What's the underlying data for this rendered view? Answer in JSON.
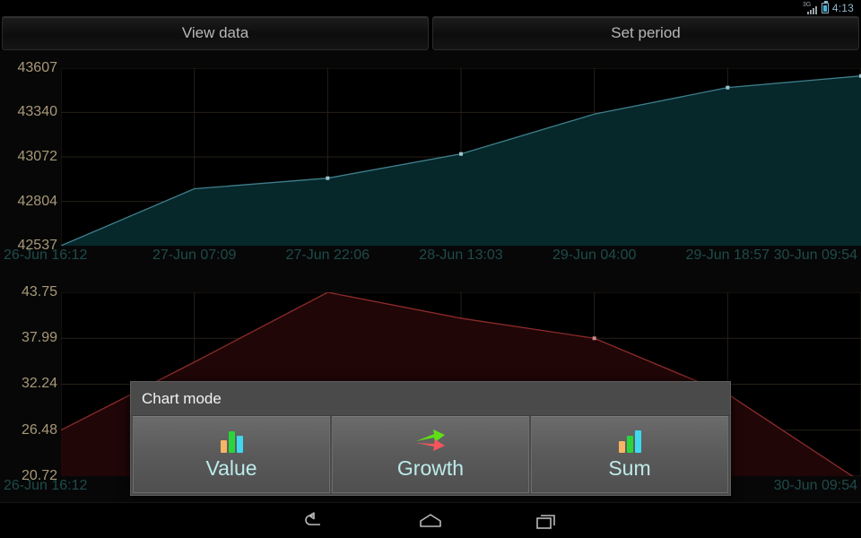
{
  "statusbar": {
    "network_label": "3G",
    "time": "4:13",
    "icons": [
      "signal-icon",
      "battery-icon"
    ]
  },
  "toolbar": {
    "view_data_label": "View data",
    "set_period_label": "Set period"
  },
  "dialog": {
    "title": "Chart mode",
    "options": [
      {
        "label": "Value",
        "icon": "bar-chart-icon"
      },
      {
        "label": "Growth",
        "icon": "growth-arrows-icon"
      },
      {
        "label": "Sum",
        "icon": "ascending-bar-chart-icon"
      }
    ]
  },
  "navbar": {
    "back_label": "Back",
    "home_label": "Home",
    "recents_label": "Recent apps"
  },
  "colors": {
    "top_line": "#3f7f8c",
    "top_fill": "#06282b",
    "bottom_line": "#8c2b2b",
    "bottom_fill": "#200607",
    "y_label": "#a79878",
    "x_label": "#1f4b4b",
    "accent_text": "#bdeaea",
    "icon_orange": "#f6b565",
    "icon_green": "#29d53a",
    "icon_cyan": "#3fd8ee",
    "icon_red": "#f2565a"
  },
  "chart_data": [
    {
      "type": "area",
      "name": "top-chart-value",
      "title": "",
      "xlabel": "",
      "ylabel": "",
      "x": [
        "26-Jun 16:12",
        "27-Jun 07:09",
        "27-Jun 22:06",
        "28-Jun 13:03",
        "29-Jun 04:00",
        "29-Jun 18:57",
        "30-Jun 09:54"
      ],
      "xtick_labels": [
        "26-Jun 16:12",
        "27-Jun 07:09",
        "27-Jun 22:06",
        "28-Jun 13:03",
        "29-Jun 04:00",
        "29-Jun 18:57",
        "30-Jun 09:54"
      ],
      "ytick_labels": [
        "43607",
        "43340",
        "43072",
        "42804",
        "42537"
      ],
      "yticks": [
        43607,
        43340,
        43072,
        42804,
        42537
      ],
      "ylim": [
        42537,
        43607
      ],
      "values": [
        42537,
        42880,
        42944,
        43090,
        43330,
        43490,
        43560
      ],
      "markers": [
        {
          "x": "27-Jun 22:06",
          "y": 42944
        },
        {
          "x": "28-Jun 13:03",
          "y": 43090
        },
        {
          "x": "29-Jun 18:57",
          "y": 43490
        },
        {
          "x": "30-Jun 09:54",
          "y": 43560
        }
      ],
      "grid": true,
      "legend": "none"
    },
    {
      "type": "area",
      "name": "bottom-chart-growth",
      "title": "",
      "xlabel": "",
      "ylabel": "",
      "x": [
        "26-Jun 16:12",
        "27-Jun 07:09",
        "27-Jun 22:06",
        "28-Jun 13:03",
        "29-Jun 04:00",
        "29-Jun 18:57",
        "30-Jun 09:54"
      ],
      "xtick_labels": [
        "26-Jun 16:12",
        "30-Jun 09:54"
      ],
      "ytick_labels": [
        "43.75",
        "37.99",
        "32.24",
        "26.48",
        "20.72"
      ],
      "yticks": [
        43.75,
        37.99,
        32.24,
        26.48,
        20.72
      ],
      "ylim": [
        20.72,
        43.75
      ],
      "values": [
        26.48,
        35.0,
        43.75,
        40.5,
        37.99,
        31.0,
        20.0
      ],
      "markers": [
        {
          "x": "29-Jun 04:00",
          "y": 37.99
        }
      ],
      "grid": true,
      "legend": "none"
    }
  ]
}
